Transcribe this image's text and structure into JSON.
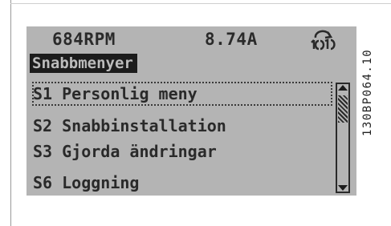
{
  "status": {
    "speed": "684RPM",
    "current": "8.74A",
    "setup_icon": "active-setup-icon"
  },
  "title": "Snabbmenyer",
  "menu": {
    "items": [
      {
        "label": "S1 Personlig meny",
        "selected": true
      },
      {
        "label": "S2 Snabbinstallation",
        "selected": false
      },
      {
        "label": "S3 Gjorda ändringar",
        "selected": false
      },
      {
        "label": "S6 Loggning",
        "selected": false
      }
    ]
  },
  "scrollbar": {
    "position": 0.0
  },
  "figure_code": "130BP064.10",
  "colors": {
    "lcd_background": "#b4b4b4",
    "lcd_text": "#2a2a2a",
    "highlight": "#1c1c1c"
  }
}
